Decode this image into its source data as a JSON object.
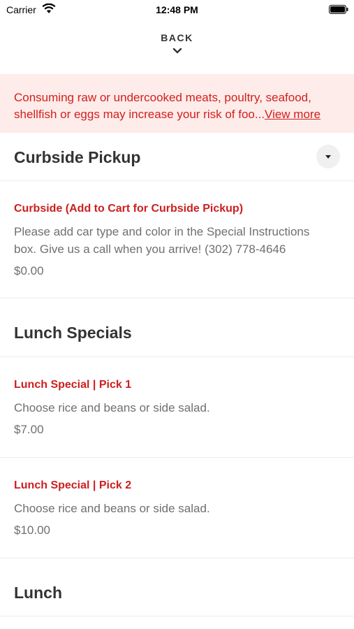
{
  "status_bar": {
    "carrier": "Carrier",
    "time": "12:48 PM",
    "wifi_icon": "wifi-icon",
    "battery_icon": "battery-icon"
  },
  "nav": {
    "back_label": "BACK",
    "chevron_icon": "chevron-down-icon"
  },
  "warning": {
    "text": "Consuming raw or undercooked meats, poultry, seafood, shellfish or eggs may increase your risk of foo...",
    "link": "View more",
    "color": "#d31f1f",
    "background": "#fdece9"
  },
  "sections": [
    {
      "title": "Curbside Pickup",
      "toggle_icon": "caret-down-icon",
      "items": [
        {
          "name": "Curbside (Add to Cart for Curbside Pickup)",
          "description": "Please add car type and color in the Special Instructions box. Give us a call when you arrive! (302) 778-4646",
          "price": "$0.00"
        }
      ]
    },
    {
      "title": "Lunch Specials",
      "items": [
        {
          "name": "Lunch Special | Pick 1",
          "description": "Choose rice and beans or side salad.",
          "price": "$7.00"
        },
        {
          "name": "Lunch Special | Pick 2",
          "description": "Choose rice and beans or side salad.",
          "price": "$10.00"
        }
      ]
    },
    {
      "title": "Lunch",
      "items": []
    }
  ],
  "colors": {
    "item_name": "#cc1f1f",
    "text_muted": "#6f6f6f",
    "divider": "#ececec"
  }
}
